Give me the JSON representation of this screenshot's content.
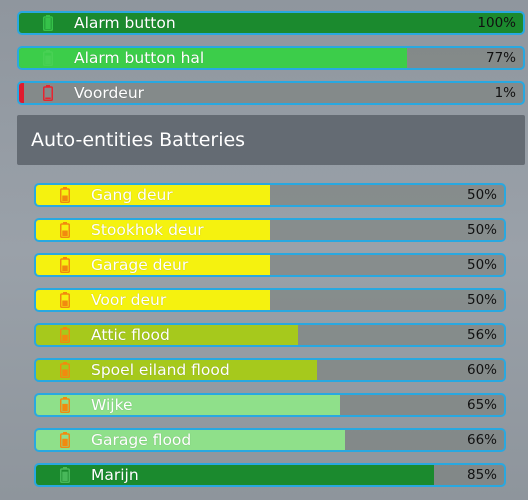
{
  "top_batteries": [
    {
      "name": "Alarm button",
      "value": "100%",
      "level": 100,
      "color": "#1b8a2e",
      "icon": "battery-full-icon",
      "icon_color": "#36c24a"
    },
    {
      "name": "Alarm button hal",
      "value": "77%",
      "level": 77,
      "color": "#3ccd4a",
      "icon": "battery-high-icon",
      "icon_color": "#48d154"
    },
    {
      "name": "Voordeur",
      "value": "1%",
      "level": 1,
      "color": "#e01b2e",
      "icon": "battery-empty-icon",
      "icon_color": "#e8232f"
    }
  ],
  "section": {
    "title": "Auto-entities Batteries"
  },
  "batteries": [
    {
      "name": "Gang deur",
      "value": "50%",
      "level": 50,
      "color": "#f5f20f",
      "icon": "battery-half-icon",
      "icon_color": "#f28a0f"
    },
    {
      "name": "Stookhok deur",
      "value": "50%",
      "level": 50,
      "color": "#f5f20f",
      "icon": "battery-half-icon",
      "icon_color": "#f28a0f"
    },
    {
      "name": "Garage deur",
      "value": "50%",
      "level": 50,
      "color": "#f5f20f",
      "icon": "battery-half-icon",
      "icon_color": "#f28a0f"
    },
    {
      "name": "Voor deur",
      "value": "50%",
      "level": 50,
      "color": "#f5f20f",
      "icon": "battery-half-icon",
      "icon_color": "#f28a0f"
    },
    {
      "name": "Attic flood",
      "value": "56%",
      "level": 56,
      "color": "#a6c91c",
      "icon": "battery-half-icon",
      "icon_color": "#f28a0f"
    },
    {
      "name": "Spoel eiland flood",
      "value": "60%",
      "level": 60,
      "color": "#a6c91c",
      "icon": "battery-half-icon",
      "icon_color": "#f28a0f"
    },
    {
      "name": "Wijke",
      "value": "65%",
      "level": 65,
      "color": "#8fe08a",
      "icon": "battery-half-icon",
      "icon_color": "#f28a0f"
    },
    {
      "name": "Garage flood",
      "value": "66%",
      "level": 66,
      "color": "#8fe08a",
      "icon": "battery-half-icon",
      "icon_color": "#f28a0f"
    },
    {
      "name": "Marijn",
      "value": "85%",
      "level": 85,
      "color": "#1b8a2e",
      "icon": "battery-high-icon",
      "icon_color": "#48b85a"
    }
  ]
}
